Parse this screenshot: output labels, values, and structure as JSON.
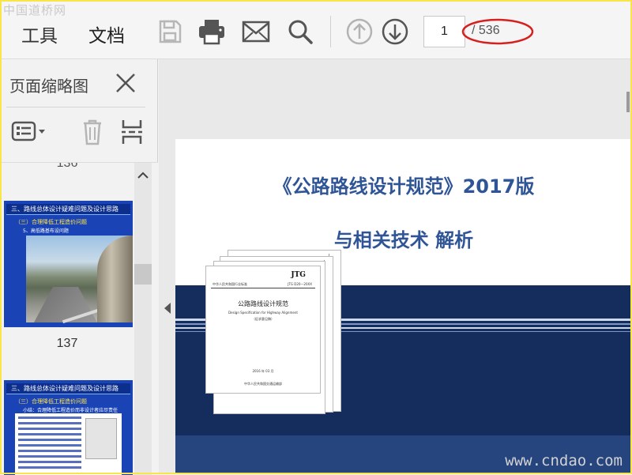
{
  "watermark": {
    "top_left": "中国道桥网",
    "bottom_right": "www.cndao.com"
  },
  "toolbar": {
    "tabs": [
      {
        "label": "工具"
      },
      {
        "label": "文档"
      }
    ],
    "icons": [
      "save-icon",
      "print-icon",
      "mail-icon",
      "search-icon",
      "arrow-up-icon",
      "arrow-down-icon"
    ],
    "page_input": "1",
    "page_total": "/ 536",
    "annotation_color": "#d62020"
  },
  "sidebar": {
    "title": "页面缩略图",
    "tool_icons": [
      "thumbnail-options-icon",
      "delete-icon",
      "extract-icon"
    ],
    "page_numbers": {
      "top_cut": "136",
      "thumb1": "137"
    },
    "thumb1": {
      "heading": "三、路线总体设计疑难问题及设计思路",
      "sub1": "（三）合理降低工程造价问题",
      "sub2": "5、高低路基布设问题"
    },
    "thumb2": {
      "heading": "三、路线总体设计疑难问题及设计思路",
      "sub1": "（三）合理降低工程造价问题",
      "sub2": "小结：合理降低工程造价而非设计者应尽责任"
    }
  },
  "document": {
    "title_line1": "《公路路线设计规范》2017版",
    "title_line2": "与相关技术 解析",
    "title_color": "#2f5597",
    "band_color": "#152d5c",
    "book": {
      "mark": "JTG",
      "standard_line": "中华人民共和国行业标准",
      "code": "JTG D20—20XX",
      "title_cn": "公路路线设计规范",
      "title_en": "Design Specification for Highway Alignment",
      "draft": "（征求意见稿）",
      "date": "2016 年 03 月",
      "publisher": "中华人民共和国交通运输部"
    }
  }
}
